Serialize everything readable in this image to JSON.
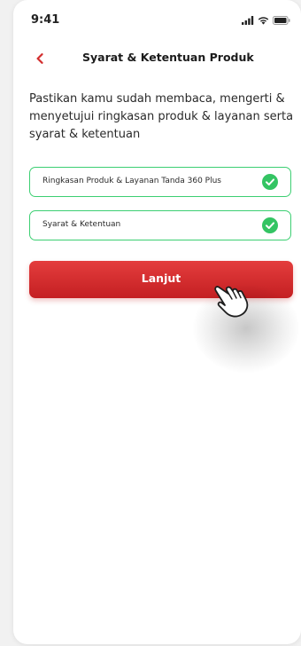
{
  "status_bar": {
    "time": "9:41",
    "icons": [
      "signal-icon",
      "wifi-icon",
      "battery-icon"
    ]
  },
  "header": {
    "title": "Syarat & Ketentuan Produk",
    "back_icon": "chevron-left-icon"
  },
  "intro_text": "Pastikan kamu sudah membaca, mengerti & menyetujui ringkasan produk & layanan serta syarat & ketentuan",
  "documents": [
    {
      "label": "Ringkasan Produk & Layanan Tanda 360 Plus",
      "status": "checked",
      "icon": "check-circle-icon"
    },
    {
      "label": "Syarat & Ketentuan",
      "status": "checked",
      "icon": "check-circle-icon"
    }
  ],
  "primary_button": {
    "label": "Lanjut"
  },
  "colors": {
    "brand_red": "#d32f2f",
    "check_green": "#34c463"
  }
}
